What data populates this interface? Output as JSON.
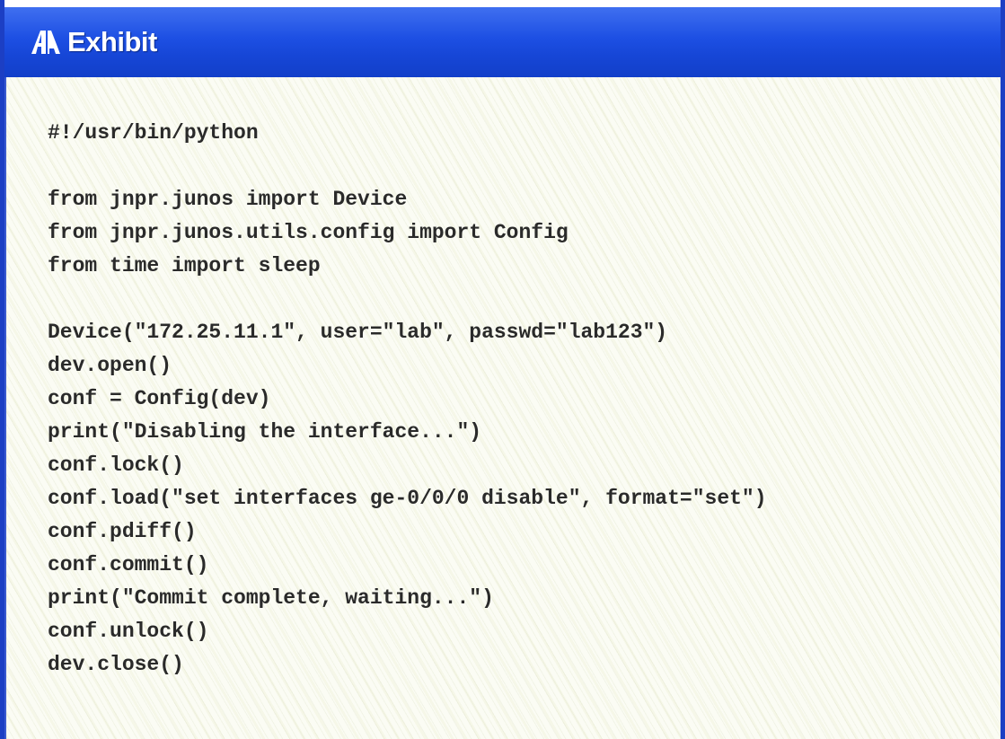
{
  "window": {
    "title": "Exhibit",
    "icon": "exhibit-icon"
  },
  "code": {
    "lines": [
      "#!/usr/bin/python",
      "",
      "from jnpr.junos import Device",
      "from jnpr.junos.utils.config import Config",
      "from time import sleep",
      "",
      "Device(\"172.25.11.1\", user=\"lab\", passwd=\"lab123\")",
      "dev.open()",
      "conf = Config(dev)",
      "print(\"Disabling the interface...\")",
      "conf.lock()",
      "conf.load(\"set interfaces ge-0/0/0 disable\", format=\"set\")",
      "conf.pdiff()",
      "conf.commit()",
      "print(\"Commit complete, waiting...\")",
      "conf.unlock()",
      "dev.close()"
    ]
  }
}
